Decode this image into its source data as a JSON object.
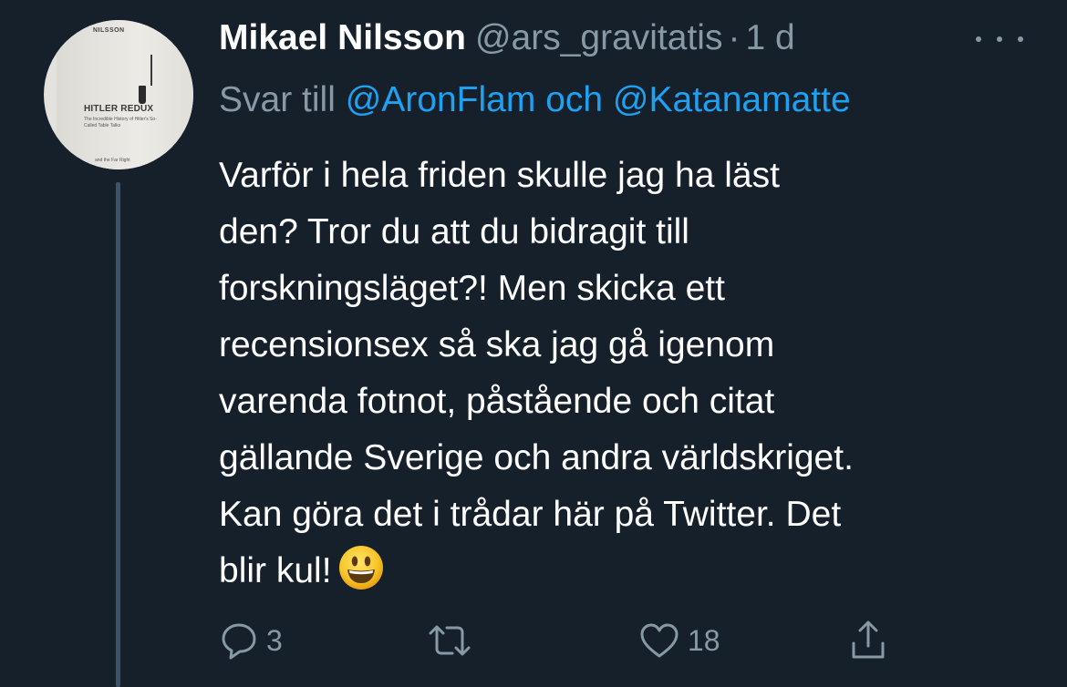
{
  "author": {
    "display_name": "Mikael Nilsson",
    "handle": "@ars_gravitatis",
    "separator": "·",
    "time": "1 d"
  },
  "avatar": {
    "author_text": "NILSSON",
    "book_title": "HITLER REDUX",
    "book_subtitle": "The Incredible History of Hitler's So-Called Table Talks",
    "book_footer": "and the Far Right"
  },
  "reply": {
    "prefix": "Svar till",
    "mention_1": "@AronFlam",
    "conjunction": "och",
    "mention_2": "@Katanamatte"
  },
  "tweet": {
    "lines": [
      "Varför i hela friden skulle jag ha läst",
      "den? Tror du att du bidragit till",
      "forskningsläget?! Men skicka ett",
      "recensionsex så ska jag gå igenom",
      "varenda fotnot, påstående och citat",
      "gällande Sverige och andra världskriget.",
      "Kan göra det i trådar här på Twitter. Det",
      "blir kul!"
    ],
    "emoji": "smiling-face-with-open-mouth"
  },
  "actions": {
    "reply_count": "3",
    "retweet_count": "",
    "like_count": "18",
    "icons": [
      "reply-icon",
      "retweet-icon",
      "like-icon",
      "share-icon"
    ]
  },
  "colors": {
    "background": "#15202b",
    "text": "#ffffff",
    "muted": "#8899a6",
    "link": "#1da1f2",
    "thread_line": "#3d5466"
  }
}
